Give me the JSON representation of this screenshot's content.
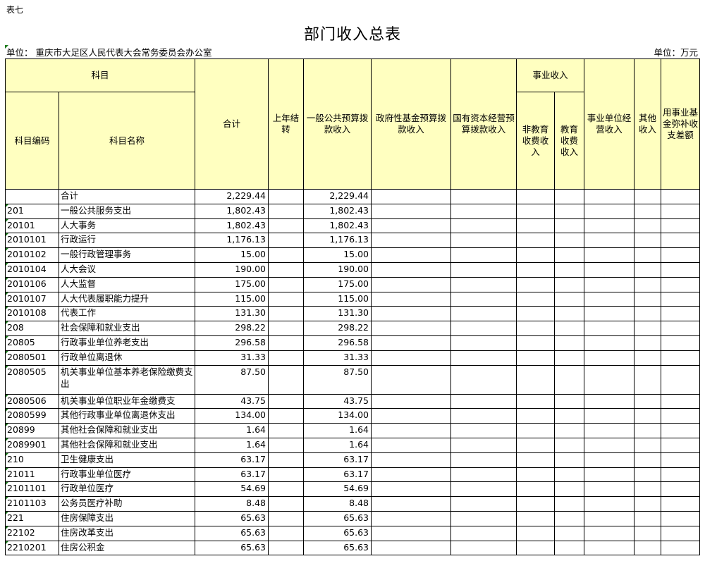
{
  "table_no": "表七",
  "title": "部门收入总表",
  "unit_left": "单位：  重庆市大足区人民代表大会常务委员会办公室",
  "unit_right": "单位：万元",
  "headers": {
    "subject": "科目",
    "code": "科目编码",
    "name": "科目名称",
    "total": "合计",
    "carryover": "上年结转",
    "general_budget": "一般公共预算拨款收入",
    "gov_fund": "政府性基金预算拨款收入",
    "state_capital": "国有资本经营预算拨款收入",
    "business_income": "事业收入",
    "non_edu_fee": "非教育收费收入",
    "edu_fee": "教育收费收入",
    "unit_operation": "事业单位经营收入",
    "other": "其他收入",
    "fund_cover": "用事业基金弥补收支差额"
  },
  "rows": [
    {
      "code": "",
      "name": "合计",
      "total": "2,229.44",
      "general": "2,229.44"
    },
    {
      "code": "201",
      "name": "一般公共服务支出",
      "total": "1,802.43",
      "general": "1,802.43"
    },
    {
      "code": "20101",
      "name": "人大事务",
      "total": "1,802.43",
      "general": "1,802.43"
    },
    {
      "code": "2010101",
      "name": "行政运行",
      "total": "1,176.13",
      "general": "1,176.13"
    },
    {
      "code": "2010102",
      "name": "一般行政管理事务",
      "total": "15.00",
      "general": "15.00"
    },
    {
      "code": "2010104",
      "name": "人大会议",
      "total": "190.00",
      "general": "190.00"
    },
    {
      "code": "2010106",
      "name": "人大监督",
      "total": "175.00",
      "general": "175.00"
    },
    {
      "code": "2010107",
      "name": "人大代表履职能力提升",
      "total": "115.00",
      "general": "115.00"
    },
    {
      "code": "2010108",
      "name": "代表工作",
      "total": "131.30",
      "general": "131.30"
    },
    {
      "code": "208",
      "name": "社会保障和就业支出",
      "total": "298.22",
      "general": "298.22"
    },
    {
      "code": "20805",
      "name": "行政事业单位养老支出",
      "total": "296.58",
      "general": "296.58"
    },
    {
      "code": "2080501",
      "name": "行政单位离退休",
      "total": "31.33",
      "general": "31.33"
    },
    {
      "code": "2080505",
      "name": "机关事业单位基本养老保险缴费支出",
      "total": "87.50",
      "general": "87.50"
    },
    {
      "code": "2080506",
      "name": "机关事业单位职业年金缴费支",
      "total": "43.75",
      "general": "43.75"
    },
    {
      "code": "2080599",
      "name": "其他行政事业单位离退休支出",
      "total": "134.00",
      "general": "134.00"
    },
    {
      "code": "20899",
      "name": "其他社会保障和就业支出",
      "total": "1.64",
      "general": "1.64"
    },
    {
      "code": "2089901",
      "name": "其他社会保障和就业支出",
      "total": "1.64",
      "general": "1.64"
    },
    {
      "code": "210",
      "name": "卫生健康支出",
      "total": "63.17",
      "general": "63.17"
    },
    {
      "code": "21011",
      "name": "行政事业单位医疗",
      "total": "63.17",
      "general": "63.17"
    },
    {
      "code": "2101101",
      "name": "行政单位医疗",
      "total": "54.69",
      "general": "54.69"
    },
    {
      "code": "2101103",
      "name": "公务员医疗补助",
      "total": "8.48",
      "general": "8.48"
    },
    {
      "code": "221",
      "name": "住房保障支出",
      "total": "65.63",
      "general": "65.63"
    },
    {
      "code": "22102",
      "name": "住房改革支出",
      "total": "65.63",
      "general": "65.63"
    },
    {
      "code": "2210201",
      "name": "住房公积金",
      "total": "65.63",
      "general": "65.63"
    }
  ]
}
